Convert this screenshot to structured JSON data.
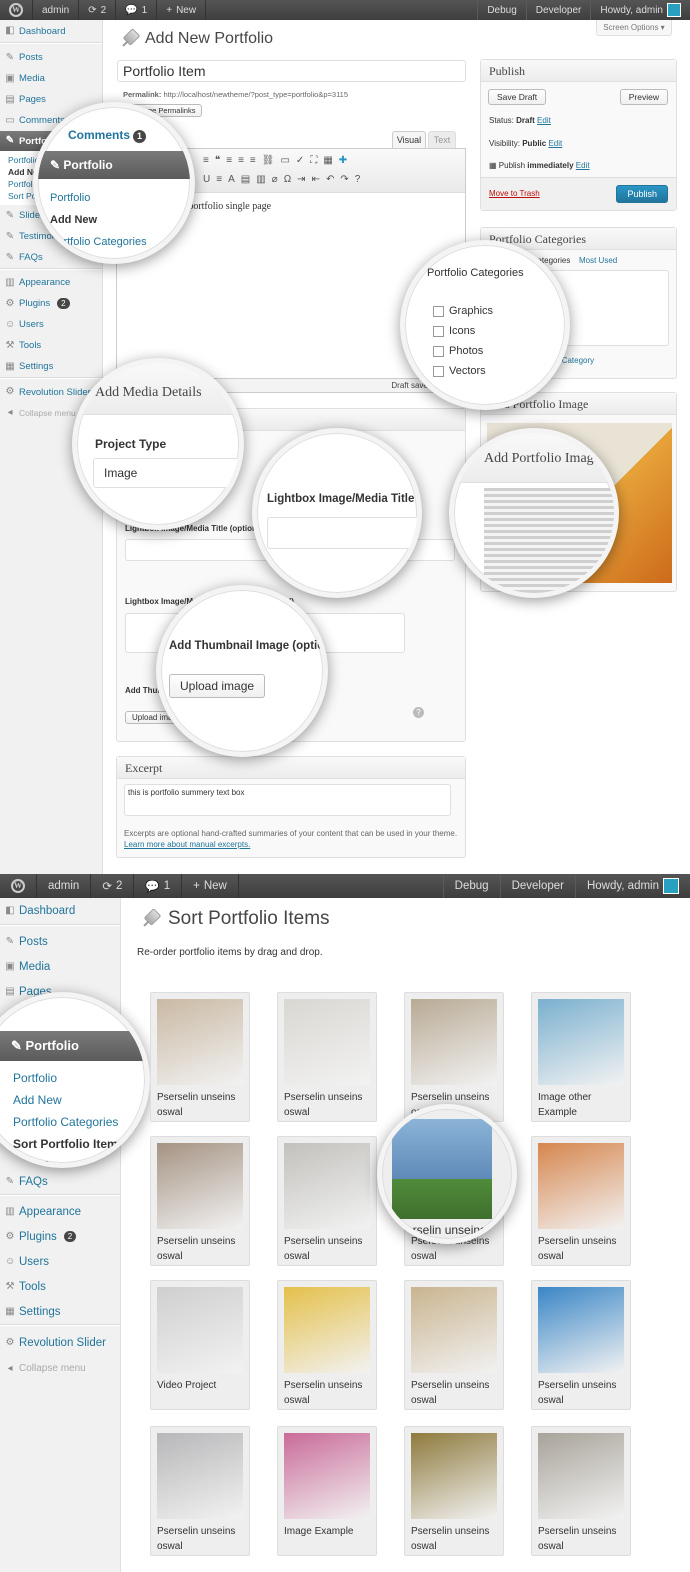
{
  "adminbar": {
    "updates_count": "2",
    "comments_count": "1",
    "site_name": "admin",
    "new_label": "New",
    "debug": "Debug",
    "developer": "Developer",
    "howdy": "Howdy, admin"
  },
  "sidebar": {
    "dashboard": "Dashboard",
    "posts": "Posts",
    "media": "Media",
    "pages": "Pages",
    "comments": "Comments",
    "comments_badge": "1",
    "portfolio": "Portfolio",
    "sub_portfolio": "Portfolio",
    "sub_add_new": "Add New",
    "sub_categories": "Portfolio Categories",
    "sub_sort": "Sort Portfolio Items",
    "slider": "Slider",
    "testimonials": "Testimonials",
    "faqs": "FAQs",
    "appearance": "Appearance",
    "plugins": "Plugins",
    "plugins_badge": "2",
    "users": "Users",
    "tools": "Tools",
    "settings": "Settings",
    "revolution": "Revolution Slider",
    "collapse": "Collapse menu"
  },
  "edit": {
    "screen_options": "Screen Options",
    "page_title": "Add New Portfolio",
    "post_title": "Portfolio Item",
    "permalink_label": "Permalink:",
    "permalink_url": "http://localhost/newtheme/?post_type=portfolio&p=3115",
    "change_permalinks": "Change Permalinks",
    "tab_visual": "Visual",
    "tab_text": "Text",
    "content": "Description for portfolio single page",
    "draft_saved": "Draft saved at 9:32",
    "excerpt_title": "Excerpt",
    "excerpt_value": "this is portfolio summery text box",
    "excerpt_help": "Excerpts are optional hand-crafted summaries of your content that can be used in your theme.",
    "excerpt_link": "Learn more about manual excerpts.",
    "lightbox_title_label": "Lightbox Image/Media Title (optional)",
    "lightbox_desc_label": "Lightbox Image/Media Description (optional)",
    "thumb_label": "Add Thumbnail Image (optional)",
    "upload_image": "Upload image"
  },
  "publish": {
    "title": "Publish",
    "save_draft": "Save Draft",
    "preview": "Preview",
    "status_label": "Status:",
    "status_value": "Draft",
    "visibility_label": "Visibility:",
    "visibility_value": "Public",
    "publish_label": "Publish",
    "publish_when": "immediately",
    "edit": "Edit",
    "move_to_trash": "Move to Trash",
    "publish_button": "Publish"
  },
  "categories": {
    "title": "Portfolio Categories",
    "tab_all": "All Portfolio Categories",
    "tab_most_used": "Most Used",
    "items": [
      "Graphics",
      "Icons",
      "Photos",
      "Vectors"
    ],
    "add_new": "+ Add New Portfolio Category"
  },
  "featured": {
    "title": "Add Portfolio Image"
  },
  "media_details": {
    "title": "Add Media Details",
    "project_type_label": "Project Type",
    "project_type_value": "Image"
  },
  "sort": {
    "page_title": "Sort Portfolio Items",
    "description": "Re-order portfolio items by drag and drop.",
    "items": [
      {
        "caption": "Pserselin unseins oswal",
        "color": "#c9b9a3"
      },
      {
        "caption": "Pserselin unseins oswal",
        "color": "#d9d7d2"
      },
      {
        "caption": "Pserselin unseins oswal",
        "color": "#b8aa94"
      },
      {
        "caption": "Image other Example",
        "color": "#7ab0cf"
      },
      {
        "caption": "Pserselin unseins oswal",
        "color": "#a59383"
      },
      {
        "caption": "Pserselin unseins oswal",
        "color": "#c2c1bd"
      },
      {
        "caption": "Pserselin unseins oswal",
        "color": "#6f8eae"
      },
      {
        "caption": "Pserselin unseins oswal",
        "color": "#d6864e"
      },
      {
        "caption": "Video Project",
        "color": "#cfcfcf"
      },
      {
        "caption": "Pserselin unseins oswal",
        "color": "#e4c04a"
      },
      {
        "caption": "Pserselin unseins oswal",
        "color": "#c9b48f"
      },
      {
        "caption": "Pserselin unseins oswal",
        "color": "#3a86c6"
      },
      {
        "caption": "Pserselin unseins oswal",
        "color": "#b7b7b9"
      },
      {
        "caption": "Image Example",
        "color": "#c96b98"
      },
      {
        "caption": "Pserselin unseins oswal",
        "color": "#8e7a3c"
      },
      {
        "caption": "Pserselin unseins oswal",
        "color": "#a8a39a"
      }
    ]
  }
}
